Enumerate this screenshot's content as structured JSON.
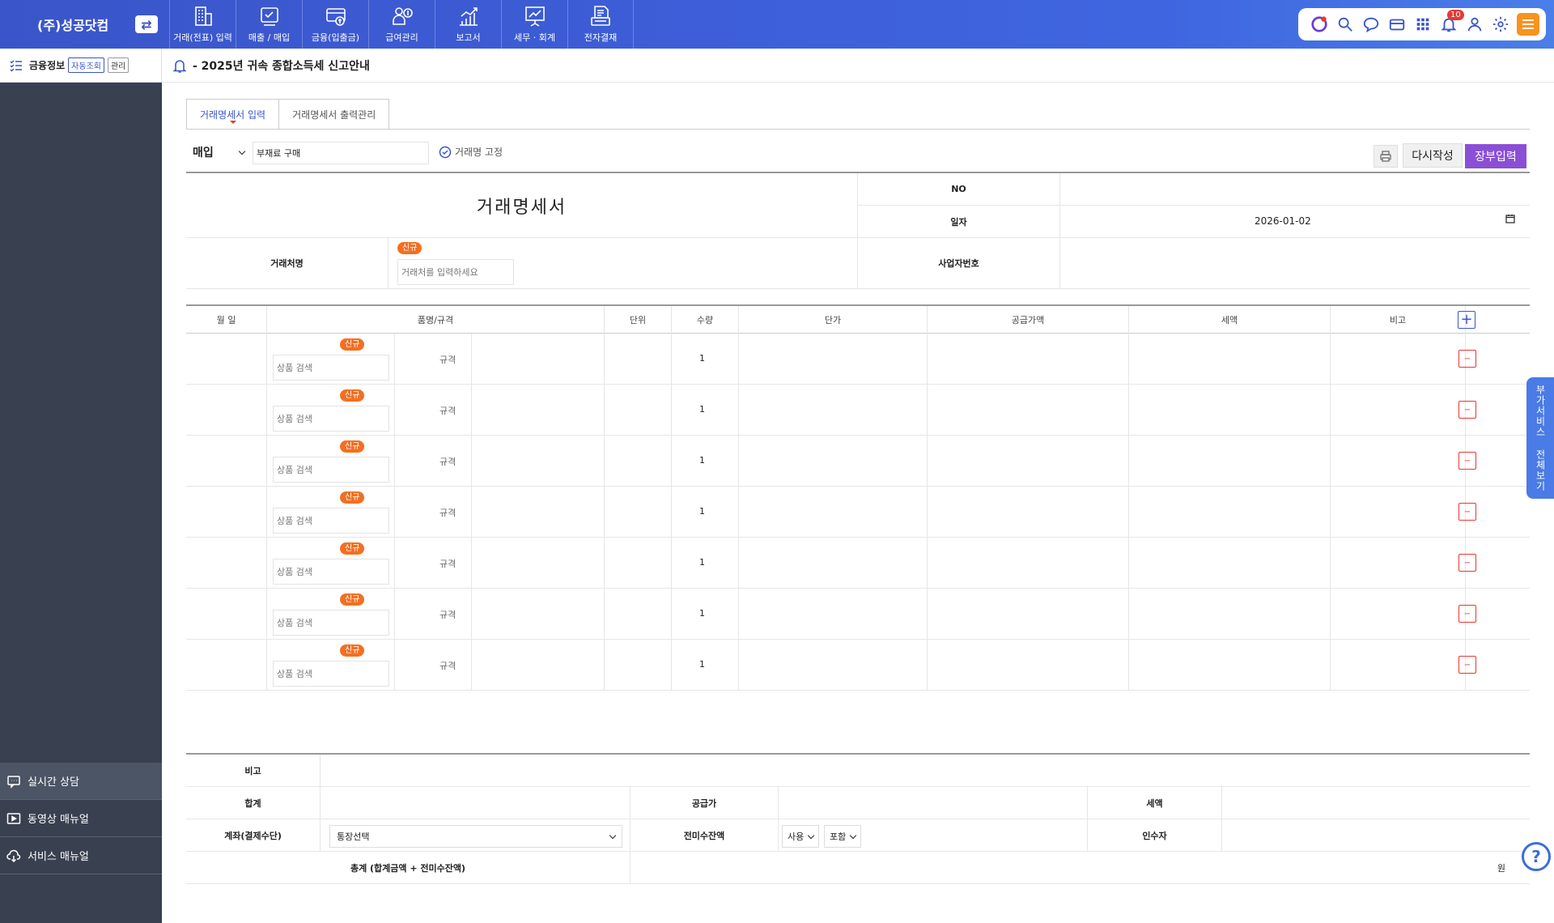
{
  "app": {
    "company": "(주)성공닷컴",
    "nav": [
      {
        "label": "거래(전표) 입력",
        "icon": "building-icon"
      },
      {
        "label": "매출 / 매입",
        "icon": "sales-icon"
      },
      {
        "label": "금융(입출금)",
        "icon": "bank-card-icon"
      },
      {
        "label": "급여관리",
        "icon": "payroll-icon"
      },
      {
        "label": "보고서",
        "icon": "report-chart-icon"
      },
      {
        "label": "세무 · 회계",
        "icon": "presentation-icon"
      },
      {
        "label": "전자결재",
        "icon": "approval-icon"
      }
    ],
    "toolbar": {
      "notification_count": "10"
    }
  },
  "sidebar": {
    "title": "금융정보",
    "tag_auto": "자동조회",
    "tag_manage": "관리",
    "menu": [
      {
        "label": "실시간 상담",
        "icon": "chat-icon"
      },
      {
        "label": "동영상 매뉴얼",
        "icon": "video-icon"
      },
      {
        "label": "서비스 매뉴얼",
        "icon": "cloud-download-icon"
      }
    ]
  },
  "notice": "- 2025년 귀속 종합소득세 신고안내",
  "tabs": [
    "거래명세서 입력",
    "거래명세서 출력관리"
  ],
  "controls": {
    "type": "매입",
    "name_value": "부재료 구매",
    "fix_label": "거래명 고정",
    "reset_label": "다시작성",
    "ledger_label": "장부입력"
  },
  "header": {
    "title": "거래명세서",
    "no_label": "NO",
    "date_label": "일자",
    "date_value": "2026-01-02",
    "client_label": "거래처명",
    "new_badge": "신규",
    "client_placeholder": "거래처를 입력하세요",
    "bizno_label": "사업자번호"
  },
  "items": {
    "columns": [
      "월 일",
      "품명/규격",
      "단위",
      "수량",
      "단가",
      "공급가액",
      "세액",
      "비고"
    ],
    "rows": [
      {
        "badge": "신규",
        "placeholder": "상품 검색",
        "spec": "규격",
        "qty": "1"
      },
      {
        "badge": "신규",
        "placeholder": "상품 검색",
        "spec": "규격",
        "qty": "1"
      },
      {
        "badge": "신규",
        "placeholder": "상품 검색",
        "spec": "규격",
        "qty": "1"
      },
      {
        "badge": "신규",
        "placeholder": "상품 검색",
        "spec": "규격",
        "qty": "1"
      },
      {
        "badge": "신규",
        "placeholder": "상품 검색",
        "spec": "규격",
        "qty": "1"
      },
      {
        "badge": "신규",
        "placeholder": "상품 검색",
        "spec": "규격",
        "qty": "1"
      },
      {
        "badge": "신규",
        "placeholder": "상품 검색",
        "spec": "규격",
        "qty": "1"
      }
    ]
  },
  "footer": {
    "remark_label": "비고",
    "total_label": "합계",
    "supply_label": "공급가",
    "tax_label": "세액",
    "account_label": "계좌(결제수단)",
    "account_value": "통장선택",
    "prev_balance_label": "전미수잔액",
    "use_value": "사용",
    "include_value": "포함",
    "receiver_label": "인수자",
    "grand_total_label": "총계 (합계금액 + 전미수잔액)",
    "won": "원"
  },
  "float_tab": "부가서비스 전체보기",
  "help": "?",
  "colors": {
    "primary": "#3a55c9",
    "sidebar": "#394150",
    "ledger_button": "#8b4fd6",
    "badge": "#f36f21",
    "menu_button": "#f7931e"
  }
}
